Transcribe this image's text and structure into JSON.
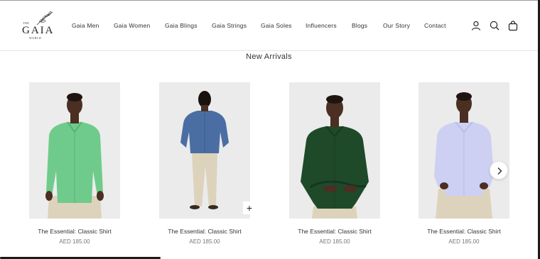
{
  "brand": {
    "the": "THE",
    "name": "GAIA",
    "world": "WORLD"
  },
  "nav": {
    "items": [
      {
        "label": "Gaia Men"
      },
      {
        "label": "Gaia Women"
      },
      {
        "label": "Gaia Blings"
      },
      {
        "label": "Gaia Strings"
      },
      {
        "label": "Gaia Soles"
      },
      {
        "label": "Influencers"
      },
      {
        "label": "Blogs"
      },
      {
        "label": "Our Story"
      },
      {
        "label": "Contact"
      }
    ]
  },
  "header_icons": [
    "account-icon",
    "search-icon",
    "cart-icon"
  ],
  "section": {
    "title": "New Arrivals"
  },
  "products": [
    {
      "name": "The Essential: Classic Shirt",
      "price": "AED 185.00",
      "shirt_color": "#6fcb8b",
      "view": "front"
    },
    {
      "name": "The Essential: Classic Shirt",
      "price": "AED 185.00",
      "shirt_color": "#4a6ea3",
      "view": "back"
    },
    {
      "name": "The Essential: Classic Shirt",
      "price": "AED 185.00",
      "shirt_color": "#1f4a2a",
      "view": "front"
    },
    {
      "name": "The Essential: Classic Shirt",
      "price": "AED 185.00",
      "shirt_color": "#cdd0f2",
      "view": "front"
    }
  ],
  "quick_add_label": "+",
  "next_icon": "chevron-right-icon"
}
